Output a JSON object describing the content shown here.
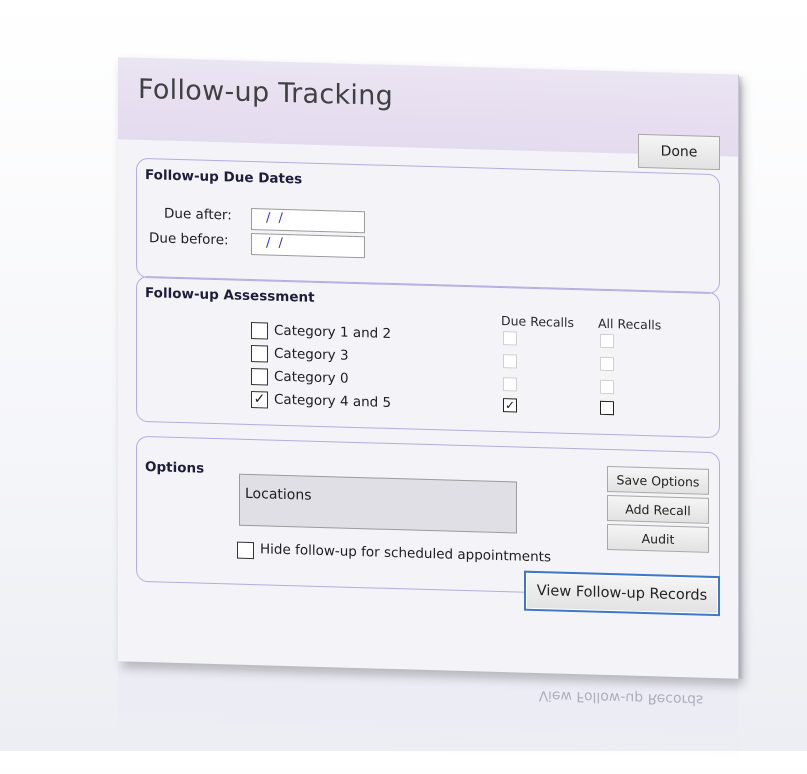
{
  "window": {
    "title": "Follow-up Tracking"
  },
  "header": {
    "done_label": "Done"
  },
  "due_dates": {
    "title": "Follow-up Due Dates",
    "after_label": "Due after:",
    "after_value": "/ /",
    "before_label": "Due before:",
    "before_value": "/ /"
  },
  "assessment": {
    "title": "Follow-up Assessment",
    "due_recalls_header": "Due Recalls",
    "all_recalls_header": "All Recalls",
    "categories": [
      {
        "label": "Category 1 and 2",
        "checked": false,
        "due_checked": false,
        "all_checked": false
      },
      {
        "label": "Category 3",
        "checked": false,
        "due_checked": false,
        "all_checked": false
      },
      {
        "label": "Category 0",
        "checked": false,
        "due_checked": false,
        "all_checked": false
      },
      {
        "label": "Category 4 and 5",
        "checked": true,
        "due_checked": true,
        "all_checked": false
      }
    ]
  },
  "options": {
    "title": "Options",
    "locations_label": "Locations",
    "hide_label": "Hide follow-up for scheduled appointments",
    "hide_checked": false,
    "save_label": "Save Options",
    "add_recall_label": "Add Recall",
    "audit_label": "Audit"
  },
  "footer": {
    "view_records_label": "View Follow-up Records"
  }
}
